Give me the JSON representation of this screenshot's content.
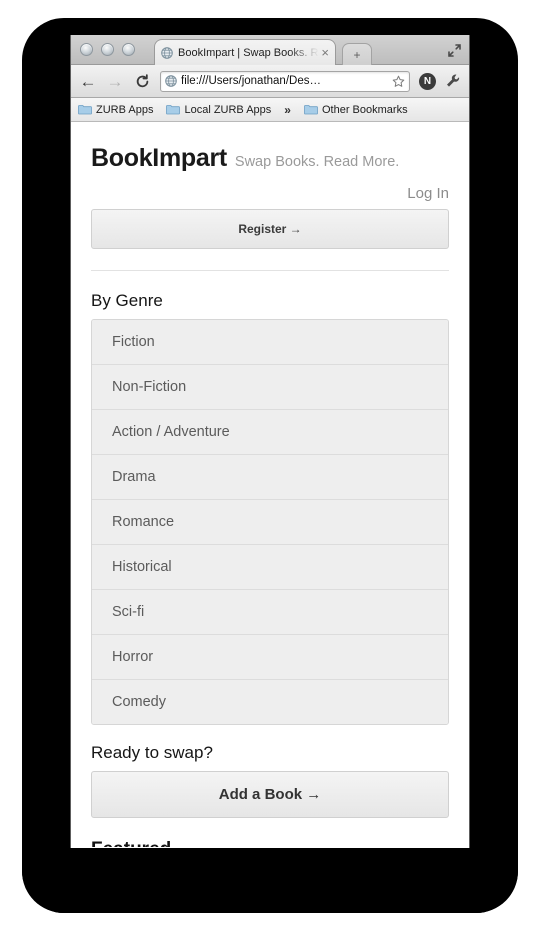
{
  "browser": {
    "tab": {
      "title": "BookImpart | Swap Books. Re",
      "close_label": "×",
      "favicon_name": "globe-icon"
    },
    "new_tab_label": "+",
    "toolbar": {
      "back_label": "←",
      "forward_label": "→",
      "reload_label": "⟳",
      "url": "file:///Users/jonathan/Des…",
      "extension_badge": "N"
    },
    "bookmarks": [
      {
        "label": "ZURB Apps"
      },
      {
        "label": "Local ZURB Apps"
      },
      {
        "label": "Other Bookmarks"
      }
    ],
    "bookmarks_overflow": "»"
  },
  "page": {
    "site_title": "BookImpart",
    "tagline": "Swap Books. Read More.",
    "login_label": "Log In",
    "register_label": "Register →",
    "genre_heading": "By Genre",
    "genres": [
      {
        "label": "Fiction"
      },
      {
        "label": "Non-Fiction"
      },
      {
        "label": "Action / Adventure"
      },
      {
        "label": "Drama"
      },
      {
        "label": "Romance"
      },
      {
        "label": "Historical"
      },
      {
        "label": "Sci-fi"
      },
      {
        "label": "Horror"
      },
      {
        "label": "Comedy"
      }
    ],
    "swap_heading": "Ready to swap?",
    "add_book_label": "Add a Book →",
    "featured_heading": "Featured"
  },
  "colors": {
    "page_bg": "#ffffff",
    "genre_bg": "#eeeeee",
    "genre_text": "#5b5b5b",
    "muted_text": "#9a9a9a",
    "frame": "#000000"
  }
}
